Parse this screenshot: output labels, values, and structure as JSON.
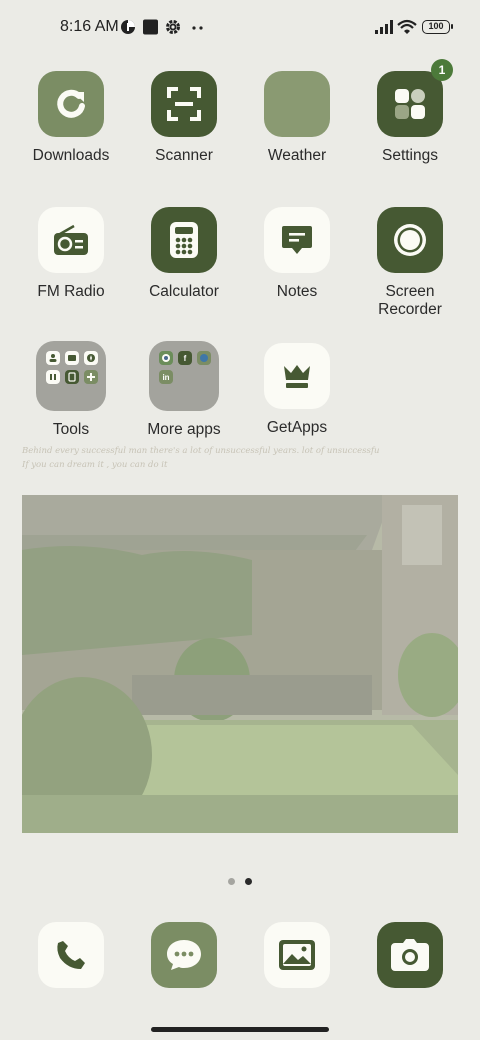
{
  "status_bar": {
    "time": "8:16 AM",
    "battery": "100",
    "icons": [
      "data-saver-icon",
      "square-notification-icon",
      "gear-icon",
      "more-dots-icon",
      "signal-icon",
      "wifi-icon",
      "battery-icon"
    ]
  },
  "home": {
    "apps": [
      {
        "label": "Downloads",
        "icon": "download-refresh-icon"
      },
      {
        "label": "Scanner",
        "icon": "scanner-icon"
      },
      {
        "label": "Weather",
        "icon": "weather-icon"
      },
      {
        "label": "Settings",
        "icon": "settings-icon",
        "badge": "1"
      },
      {
        "label": "FM Radio",
        "icon": "radio-icon"
      },
      {
        "label": "Calculator",
        "icon": "calculator-icon"
      },
      {
        "label": "Notes",
        "icon": "notes-icon"
      },
      {
        "label": "Screen Recorder",
        "icon": "screen-record-icon"
      },
      {
        "label": "Tools",
        "icon": "folder-icon"
      },
      {
        "label": "More apps",
        "icon": "folder-icon"
      },
      {
        "label": "GetApps",
        "icon": "crown-icon"
      }
    ],
    "more_apps_folder": [
      "f",
      "in"
    ],
    "quote_line1": "Behind every successful man there's a lot of unsuccessful years. lot of unsuccessfu",
    "quote_line2": "If you can dream it , you can do it"
  },
  "page_indicator": {
    "pages": 2,
    "current": 2
  },
  "dock": [
    {
      "name": "phone",
      "icon": "phone-icon"
    },
    {
      "name": "messages",
      "icon": "message-icon"
    },
    {
      "name": "gallery",
      "icon": "gallery-icon"
    },
    {
      "name": "camera",
      "icon": "camera-icon"
    }
  ],
  "colors": {
    "background": "#ebebe6",
    "dark_green": "#465933",
    "mid_green": "#7b8d64",
    "light_icon": "#fbfbf5",
    "badge": "#4c7a3a"
  }
}
